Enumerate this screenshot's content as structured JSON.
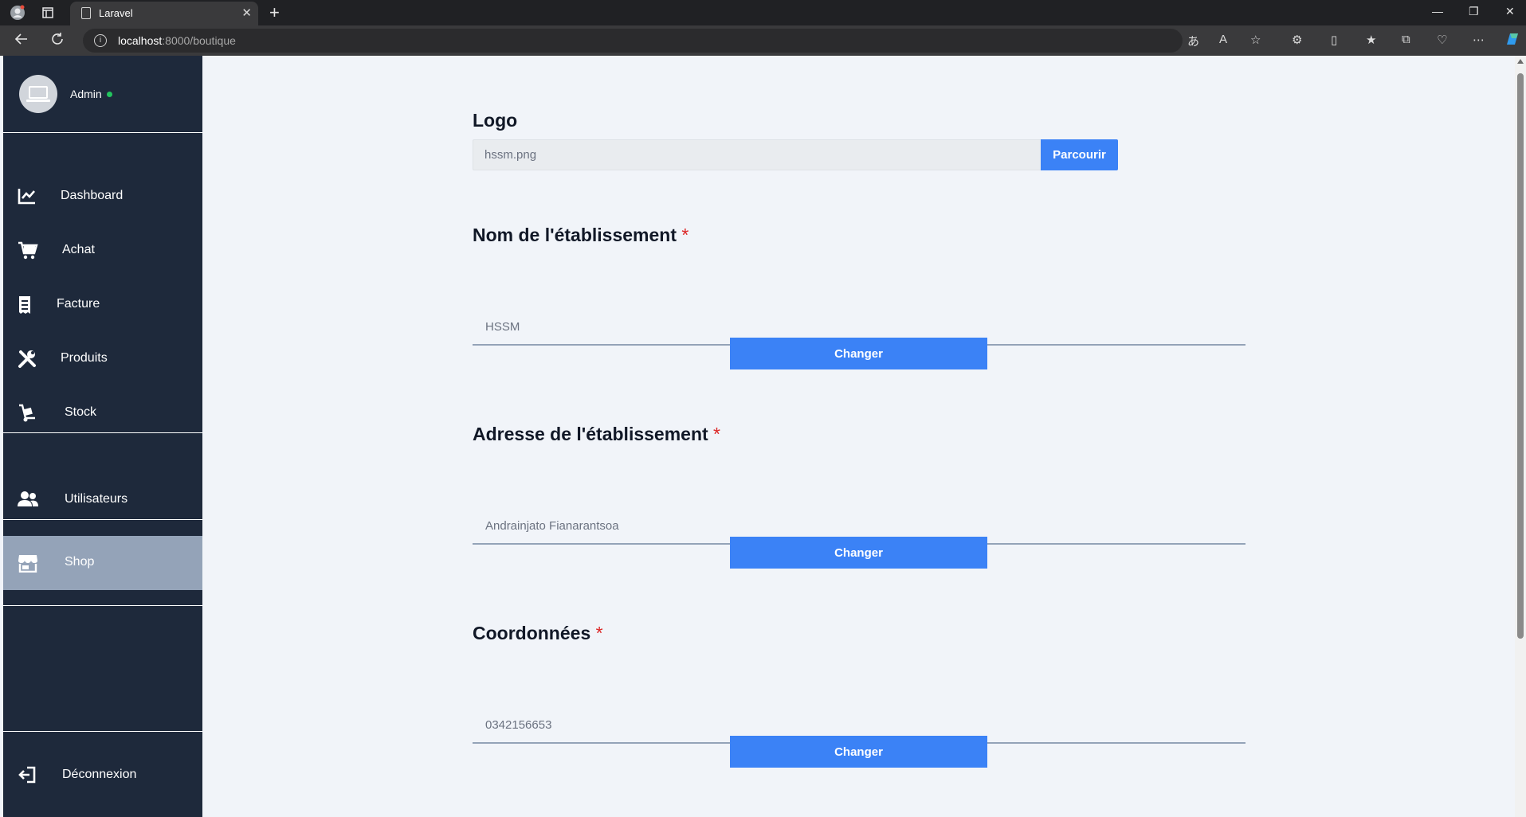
{
  "browser": {
    "tab_title": "Laravel",
    "tab_close": "✕",
    "new_tab": "+",
    "url_host": "localhost",
    "url_rest": ":8000/boutique",
    "icons": [
      "profile-icon",
      "tab-actions-icon",
      "back-icon",
      "refresh-icon",
      "site-info-icon",
      "read-aloud-icon",
      "favorite-icon",
      "extensions-icon",
      "split-screen-icon",
      "favorites-icon",
      "collections-icon",
      "performance-icon",
      "more-icon",
      "copilot-icon"
    ]
  },
  "sidebar": {
    "user_name": "Admin",
    "online_color": "#22c55e",
    "items": [
      {
        "label": "Dashboard",
        "icon": "chart-line-icon"
      },
      {
        "label": "Achat",
        "icon": "cart-icon"
      },
      {
        "label": "Facture",
        "icon": "receipt-icon"
      },
      {
        "label": "Produits",
        "icon": "tools-icon"
      },
      {
        "label": "Stock",
        "icon": "dolly-icon"
      },
      {
        "label": "Utilisateurs",
        "icon": "users-icon"
      },
      {
        "label": "Shop",
        "icon": "store-icon",
        "active": true
      },
      {
        "label": "Déconnexion",
        "icon": "logout-icon"
      }
    ]
  },
  "form": {
    "logo": {
      "title": "Logo",
      "file_name": "hssm.png",
      "browse_label": "Parcourir"
    },
    "name": {
      "title": "Nom de l'établissement",
      "required": "*",
      "value": "HSSM",
      "button": "Changer"
    },
    "address": {
      "title": "Adresse de l'établissement",
      "required": "*",
      "value": "Andrainjato Fianarantsoa",
      "button": "Changer"
    },
    "contact": {
      "title": "Coordonnées",
      "required": "*",
      "value": "0342156653",
      "button": "Changer"
    }
  },
  "colors": {
    "sidebar_bg": "#1e293b",
    "active_bg": "#94a3b8",
    "accent": "#3b82f6",
    "required": "#dc2626"
  }
}
